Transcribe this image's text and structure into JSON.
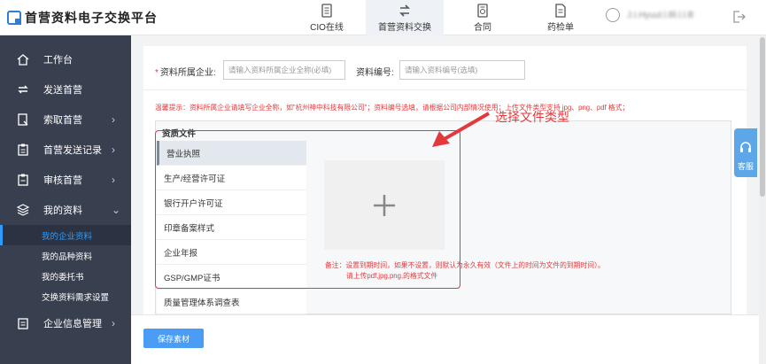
{
  "brand": {
    "name": "首营资料电子交换平台"
  },
  "nav": [
    {
      "label": "CIO在线",
      "icon": "document-icon"
    },
    {
      "label": "首营资料交换",
      "icon": "exchange-icon"
    },
    {
      "label": "合同",
      "icon": "contract-icon"
    },
    {
      "label": "药检单",
      "icon": "report-icon"
    }
  ],
  "user": {
    "name": "J.I.Hyuul.l.llll.l.l.lll"
  },
  "sidebar": {
    "items": [
      {
        "label": "工作台",
        "icon": "home-icon",
        "arrow": ""
      },
      {
        "label": "发送首营",
        "icon": "send-icon",
        "arrow": ""
      },
      {
        "label": "索取首营",
        "icon": "request-icon",
        "arrow": "›"
      },
      {
        "label": "首营发送记录",
        "icon": "clipboard-icon",
        "arrow": "›"
      },
      {
        "label": "审核首营",
        "icon": "audit-icon",
        "arrow": "›"
      },
      {
        "label": "我的资料",
        "icon": "layers-icon",
        "arrow": "⌄"
      }
    ],
    "subitems": [
      "我的企业资料",
      "我的品种资料",
      "我的委托书",
      "交换资料需求设置"
    ],
    "bottom_item": {
      "label": "企业信息管理",
      "icon": "company-icon",
      "arrow": "›"
    }
  },
  "form": {
    "company_label": "资料所属企业:",
    "company_placeholder": "请输入资料所属企业全称(必填)",
    "code_label": "资料编号:",
    "code_placeholder": "请输入资料编号(选填)",
    "required_mark": "*"
  },
  "tip": "温馨提示：资料所属企业请填写企业全称，如\"杭州神中科技有限公司\"；资料编号选填，请根据公司内部情况使用；上传文件类型支持 jpg、png、pdf 格式；",
  "qualification": {
    "title": "资质文件",
    "types": [
      "营业执照",
      "生产/经营许可证",
      "银行开户许可证",
      "印章备案样式",
      "企业年报",
      "GSP/GMP证书",
      "质量管理体系调查表"
    ],
    "upload_symbol": "+"
  },
  "notes": {
    "line1": "备注：设置到期时间，如果不设置，则默认为永久有效（文件上的时间为文件的到期时间）。",
    "line2": "请上传pdf,jpg,png,的格式文件"
  },
  "annotation": "选择文件类型",
  "service": {
    "label": "客服"
  },
  "save_button": "保存素材",
  "colors": {
    "accent": "#2f9bff",
    "sidebar": "#383f4f",
    "warning": "#e4393c",
    "button": "#4a9cf4"
  }
}
